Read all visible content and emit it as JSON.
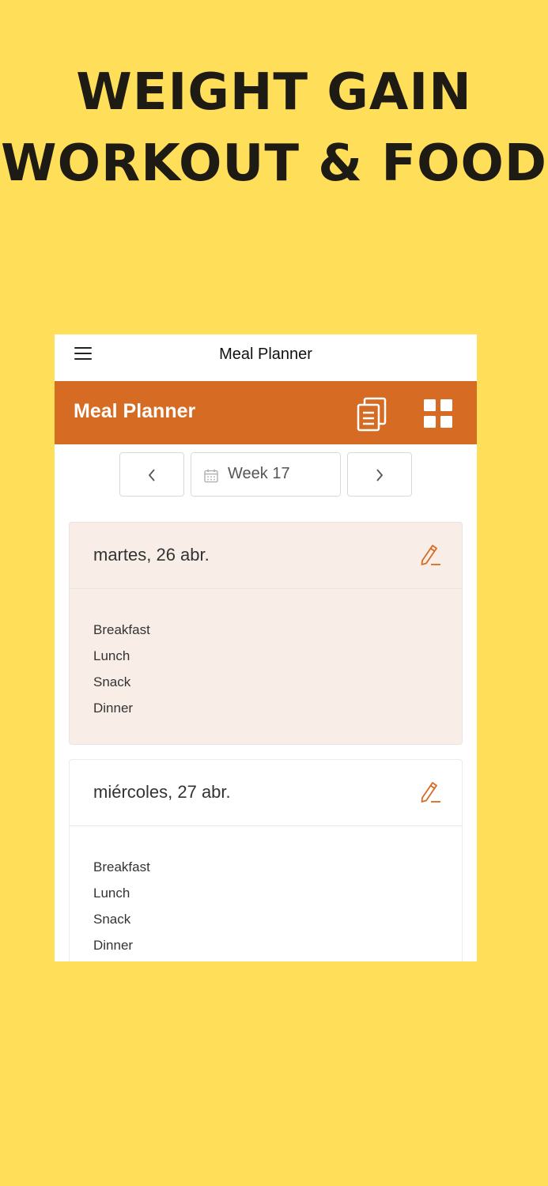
{
  "promo": {
    "line1": "WEIGHT GAIN",
    "line2": "WORKOUT & FOOD"
  },
  "topbar": {
    "title": "Meal Planner",
    "menu_icon": "hamburger-menu-icon"
  },
  "appbar": {
    "title": "Meal Planner",
    "color": "#D66B24",
    "actions": [
      "copy-icon",
      "grid-view-icon"
    ]
  },
  "week_nav": {
    "week_label": "Week 17",
    "prev_icon": "chevron-left-icon",
    "next_icon": "chevron-right-icon",
    "calendar_icon": "calendar-icon"
  },
  "days": [
    {
      "title": "martes, 26 abr.",
      "meals": [
        "Breakfast",
        "Lunch",
        "Snack",
        "Dinner"
      ]
    },
    {
      "title": "miércoles, 27 abr.",
      "meals": [
        "Breakfast",
        "Lunch",
        "Snack",
        "Dinner"
      ]
    }
  ],
  "colors": {
    "background": "#FFDE59",
    "accent": "#D66B24",
    "highlight_card": "#F9EEE7"
  }
}
